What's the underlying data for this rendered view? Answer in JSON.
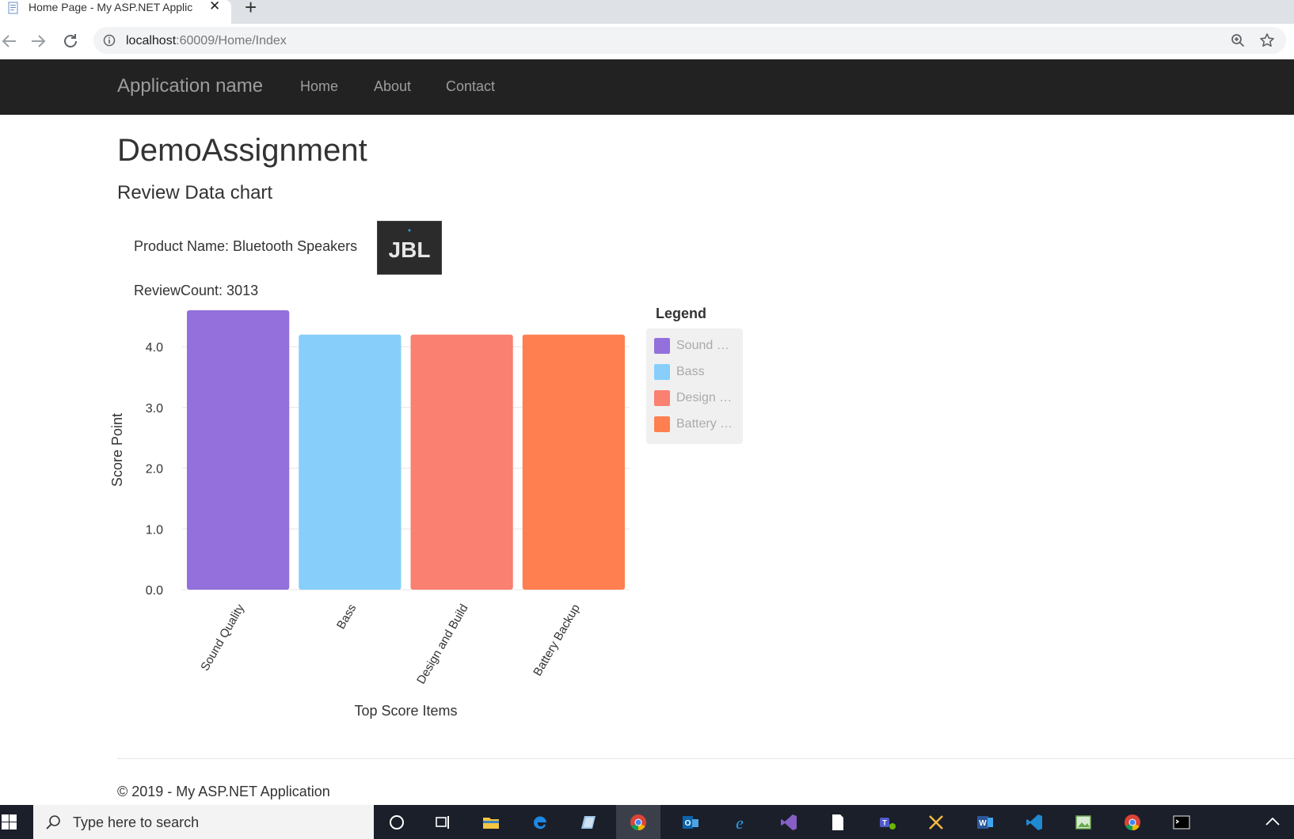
{
  "browser": {
    "tab_title": "Home Page - My ASP.NET Applic",
    "url_host": "localhost",
    "url_rest": ":60009/Home/Index"
  },
  "navbar": {
    "brand": "Application name",
    "links": [
      "Home",
      "About",
      "Contact"
    ]
  },
  "page": {
    "title": "DemoAssignment",
    "subtitle": "Review Data chart",
    "product_name_line": "Product Name: Bluetooth Speakers",
    "review_count_line": "ReviewCount: 3013",
    "logo_text": "JBL"
  },
  "legend": {
    "title": "Legend",
    "items": [
      "Sound …",
      "Bass",
      "Design …",
      "Battery …"
    ]
  },
  "chart_data": {
    "type": "bar",
    "categories": [
      "Sound Quality",
      "Bass",
      "Design and Build",
      "Battery Backup"
    ],
    "values": [
      4.6,
      4.2,
      4.2,
      4.2
    ],
    "colors": [
      "#9370db",
      "#87cefa",
      "#fa8072",
      "#ff7f50"
    ],
    "xlabel": "Top Score Items",
    "ylabel": "Score Point",
    "ylim": [
      0,
      4.6
    ],
    "yticks": [
      "0.0",
      "1.0",
      "2.0",
      "3.0",
      "4.0"
    ],
    "grid": true
  },
  "footer": {
    "text": "© 2019 - My ASP.NET Application"
  },
  "taskbar": {
    "search_placeholder": "Type here to search",
    "apps": [
      "cortana-icon",
      "task-view-icon",
      "file-explorer-icon",
      "edge-icon",
      "app-icon",
      "chrome-icon",
      "outlook-icon",
      "internet-explorer-icon",
      "visual-studio-icon",
      "notepad-icon",
      "teams-icon",
      "tools-icon",
      "word-icon",
      "vscode-icon",
      "image-editor-icon",
      "chrome-icon-2",
      "terminal-icon"
    ]
  }
}
